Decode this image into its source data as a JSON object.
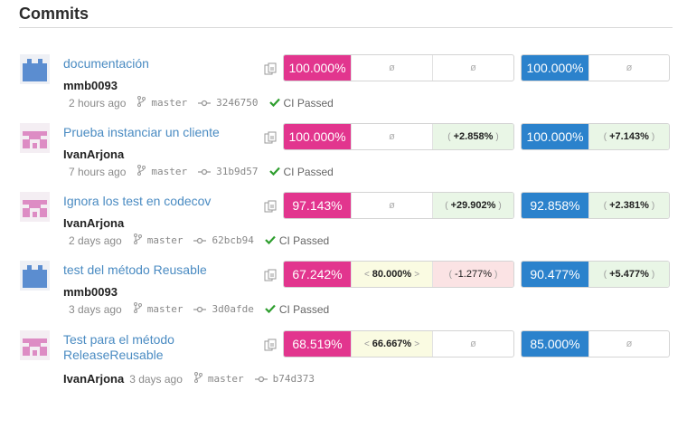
{
  "heading": "Commits",
  "empty_symbol": "ø",
  "ci_label": "CI Passed",
  "commits": [
    {
      "title": "documentación",
      "author": "mmb0093",
      "time": "2 hours ago",
      "branch": "master",
      "hash": "3246750",
      "ci": "CI Passed",
      "avatar": "blue",
      "cov_main": "100.000%",
      "cov_b": "ø",
      "cov_c": "ø",
      "cov2_main": "100.000%",
      "cov2_b": "ø"
    },
    {
      "title": "Prueba instanciar un cliente",
      "author": "IvanArjona",
      "time": "7 hours ago",
      "branch": "master",
      "hash": "31b9d57",
      "ci": "CI Passed",
      "avatar": "pink",
      "cov_main": "100.000%",
      "cov_b": "ø",
      "cov_c": "+2.858%",
      "cov2_main": "100.000%",
      "cov2_b": "+7.143%"
    },
    {
      "title": "Ignora los test en codecov",
      "author": "IvanArjona",
      "time": "2 days ago",
      "branch": "master",
      "hash": "62bcb94",
      "ci": "CI Passed",
      "avatar": "pink",
      "cov_main": "97.143%",
      "cov_b": "ø",
      "cov_c": "+29.902%",
      "cov2_main": "92.858%",
      "cov2_b": "+2.381%"
    },
    {
      "title": "test del método Reusable",
      "author": "mmb0093",
      "time": "3 days ago",
      "branch": "master",
      "hash": "3d0afde",
      "ci": "CI Passed",
      "avatar": "blue",
      "cov_main": "67.242%",
      "cov_b": "80.000%",
      "cov_c": "-1.277%",
      "cov2_main": "90.477%",
      "cov2_b": "+5.477%"
    },
    {
      "title": "Test para el método ReleaseReusable",
      "author": "IvanArjona",
      "time": "3 days ago",
      "branch": "master",
      "hash": "b74d373",
      "avatar": "pink",
      "cov_main": "68.519%",
      "cov_b": "66.667%",
      "cov_c": "ø",
      "cov2_main": "85.000%",
      "cov2_b": "ø"
    }
  ],
  "colors": {
    "pink": "#e2358e",
    "blue": "#2b82cc",
    "link": "#4a8bc2",
    "check": "#2e9e2e",
    "avatar_blue": "#5b8dd0",
    "avatar_pink": "#dd8cc4"
  }
}
